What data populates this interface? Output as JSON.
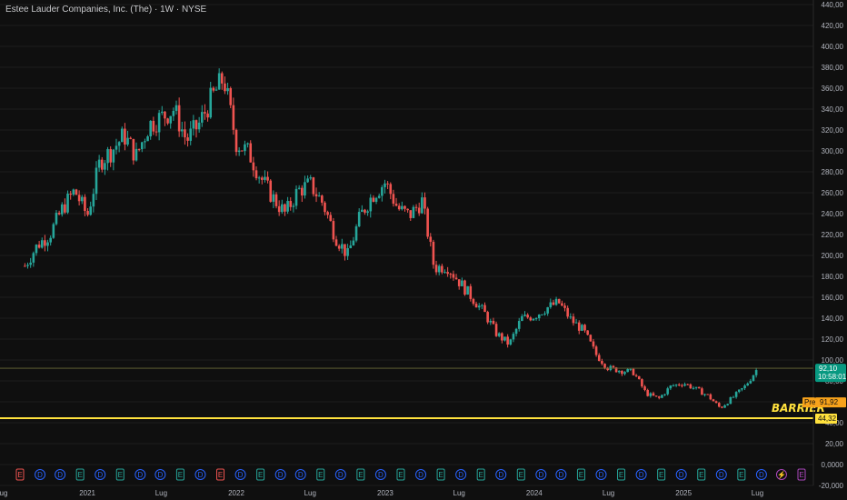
{
  "header": {
    "title": "Estee Lauder Companies, Inc. (The) · 1W · NYSE"
  },
  "price_tags": {
    "last_price": "92,10",
    "countdown": "10:58:01",
    "pre_label": "Pre",
    "pre_price": "91,92",
    "barrier_price": "44,32"
  },
  "annotation": {
    "barrier_label": "BARRIER"
  },
  "colors": {
    "up": "#26a69a",
    "down": "#ef5350",
    "barrier": "#ffe13d",
    "last_price_tag": "#089981",
    "pre_tag": "#f7a21b",
    "grid": "#1d1d1d"
  },
  "events": [
    "E",
    "D",
    "D",
    "E",
    "D",
    "E",
    "D",
    "D",
    "E",
    "D",
    "E",
    "D",
    "E",
    "D",
    "D",
    "E",
    "D",
    "E",
    "D",
    "E",
    "D",
    "E",
    "D",
    "E",
    "D",
    "E",
    "D",
    "D",
    "E",
    "D",
    "E",
    "D",
    "E",
    "D",
    "E",
    "D",
    "E",
    "D",
    "dividend-bolt",
    "E"
  ],
  "chart_data": {
    "type": "candlestick",
    "title": "Estee Lauder Companies, Inc. (The) · 1W · NYSE",
    "ylim": [
      -20,
      440
    ],
    "y_ticks": [
      "440,00",
      "420,00",
      "400,00",
      "380,00",
      "360,00",
      "340,00",
      "320,00",
      "300,00",
      "280,00",
      "260,00",
      "240,00",
      "220,00",
      "200,00",
      "180,00",
      "160,00",
      "140,00",
      "120,00",
      "100,00",
      "80,00",
      "60,00",
      "40,00",
      "20,00",
      "0,0000",
      "-20,000"
    ],
    "y_tick_values": [
      440,
      420,
      400,
      380,
      360,
      340,
      320,
      300,
      280,
      260,
      240,
      220,
      200,
      180,
      160,
      140,
      120,
      100,
      80,
      60,
      40,
      20,
      0,
      -20
    ],
    "x_ticks": [
      "ug",
      "2021",
      "Lug",
      "2022",
      "Lug",
      "2023",
      "Lug",
      "2024",
      "Lug",
      "2025",
      "Lug"
    ],
    "x_tick_dates": [
      "2020-08-01",
      "2021-01-01",
      "2021-07-01",
      "2022-01-01",
      "2022-07-01",
      "2023-01-01",
      "2023-07-01",
      "2024-01-01",
      "2024-07-01",
      "2025-01-01",
      "2025-07-01"
    ],
    "series": [
      {
        "points": [
          [
            "2020-08-01",
            190
          ],
          [
            "2020-09-01",
            210
          ],
          [
            "2020-10-01",
            220
          ],
          [
            "2020-11-01",
            245
          ],
          [
            "2020-12-01",
            262
          ],
          [
            "2021-01-01",
            238
          ],
          [
            "2021-02-01",
            290
          ],
          [
            "2021-03-01",
            300
          ],
          [
            "2021-04-01",
            315
          ],
          [
            "2021-05-01",
            295
          ],
          [
            "2021-06-01",
            325
          ],
          [
            "2021-07-01",
            332
          ],
          [
            "2021-08-01",
            340
          ],
          [
            "2021-09-01",
            310
          ],
          [
            "2021-10-01",
            325
          ],
          [
            "2021-11-01",
            350
          ],
          [
            "2021-12-01",
            370
          ],
          [
            "2022-01-01",
            308
          ],
          [
            "2022-02-01",
            298
          ],
          [
            "2022-03-01",
            275
          ],
          [
            "2022-04-01",
            255
          ],
          [
            "2022-05-01",
            240
          ],
          [
            "2022-06-01",
            262
          ],
          [
            "2022-07-01",
            268
          ],
          [
            "2022-08-01",
            250
          ],
          [
            "2022-09-01",
            218
          ],
          [
            "2022-10-01",
            200
          ],
          [
            "2022-11-01",
            238
          ],
          [
            "2022-12-01",
            258
          ],
          [
            "2023-01-01",
            270
          ],
          [
            "2023-02-01",
            245
          ],
          [
            "2023-03-01",
            238
          ],
          [
            "2023-04-01",
            252
          ],
          [
            "2023-05-01",
            188
          ],
          [
            "2023-06-01",
            190
          ],
          [
            "2023-07-01",
            175
          ],
          [
            "2023-08-01",
            160
          ],
          [
            "2023-09-01",
            145
          ],
          [
            "2023-10-01",
            125
          ],
          [
            "2023-11-01",
            115
          ],
          [
            "2023-12-01",
            140
          ],
          [
            "2024-01-01",
            142
          ],
          [
            "2024-02-01",
            150
          ],
          [
            "2024-03-01",
            155
          ],
          [
            "2024-04-01",
            138
          ],
          [
            "2024-05-01",
            128
          ],
          [
            "2024-06-01",
            105
          ],
          [
            "2024-07-01",
            92
          ],
          [
            "2024-08-01",
            90
          ],
          [
            "2024-09-01",
            88
          ],
          [
            "2024-10-01",
            68
          ],
          [
            "2024-11-01",
            63
          ],
          [
            "2024-12-01",
            75
          ],
          [
            "2025-01-01",
            78
          ],
          [
            "2025-02-01",
            72
          ],
          [
            "2025-03-01",
            66
          ],
          [
            "2025-04-01",
            54
          ],
          [
            "2025-05-01",
            64
          ],
          [
            "2025-06-01",
            75
          ],
          [
            "2025-07-01",
            92
          ]
        ]
      }
    ]
  }
}
